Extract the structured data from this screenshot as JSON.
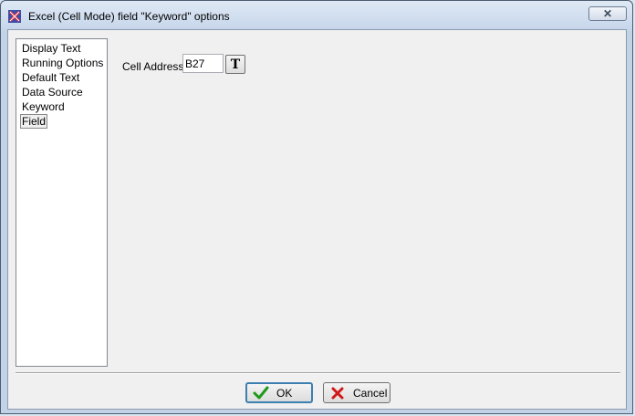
{
  "window": {
    "title": "Excel (Cell Mode) field \"Keyword\" options",
    "close_glyph": "✕"
  },
  "nav": {
    "items": [
      {
        "label": "Display Text"
      },
      {
        "label": "Running Options"
      },
      {
        "label": "Default Text"
      },
      {
        "label": "Data Source"
      },
      {
        "label": "Keyword"
      },
      {
        "label": "Field",
        "selected": true
      }
    ]
  },
  "form": {
    "cell_address_label": "Cell Address",
    "cell_address_value": "B27",
    "text_button_glyph": "T"
  },
  "buttons": {
    "ok_label": "OK",
    "cancel_label": "Cancel"
  },
  "colors": {
    "ok_icon": "#1c9a1c",
    "cancel_icon": "#d01818"
  }
}
